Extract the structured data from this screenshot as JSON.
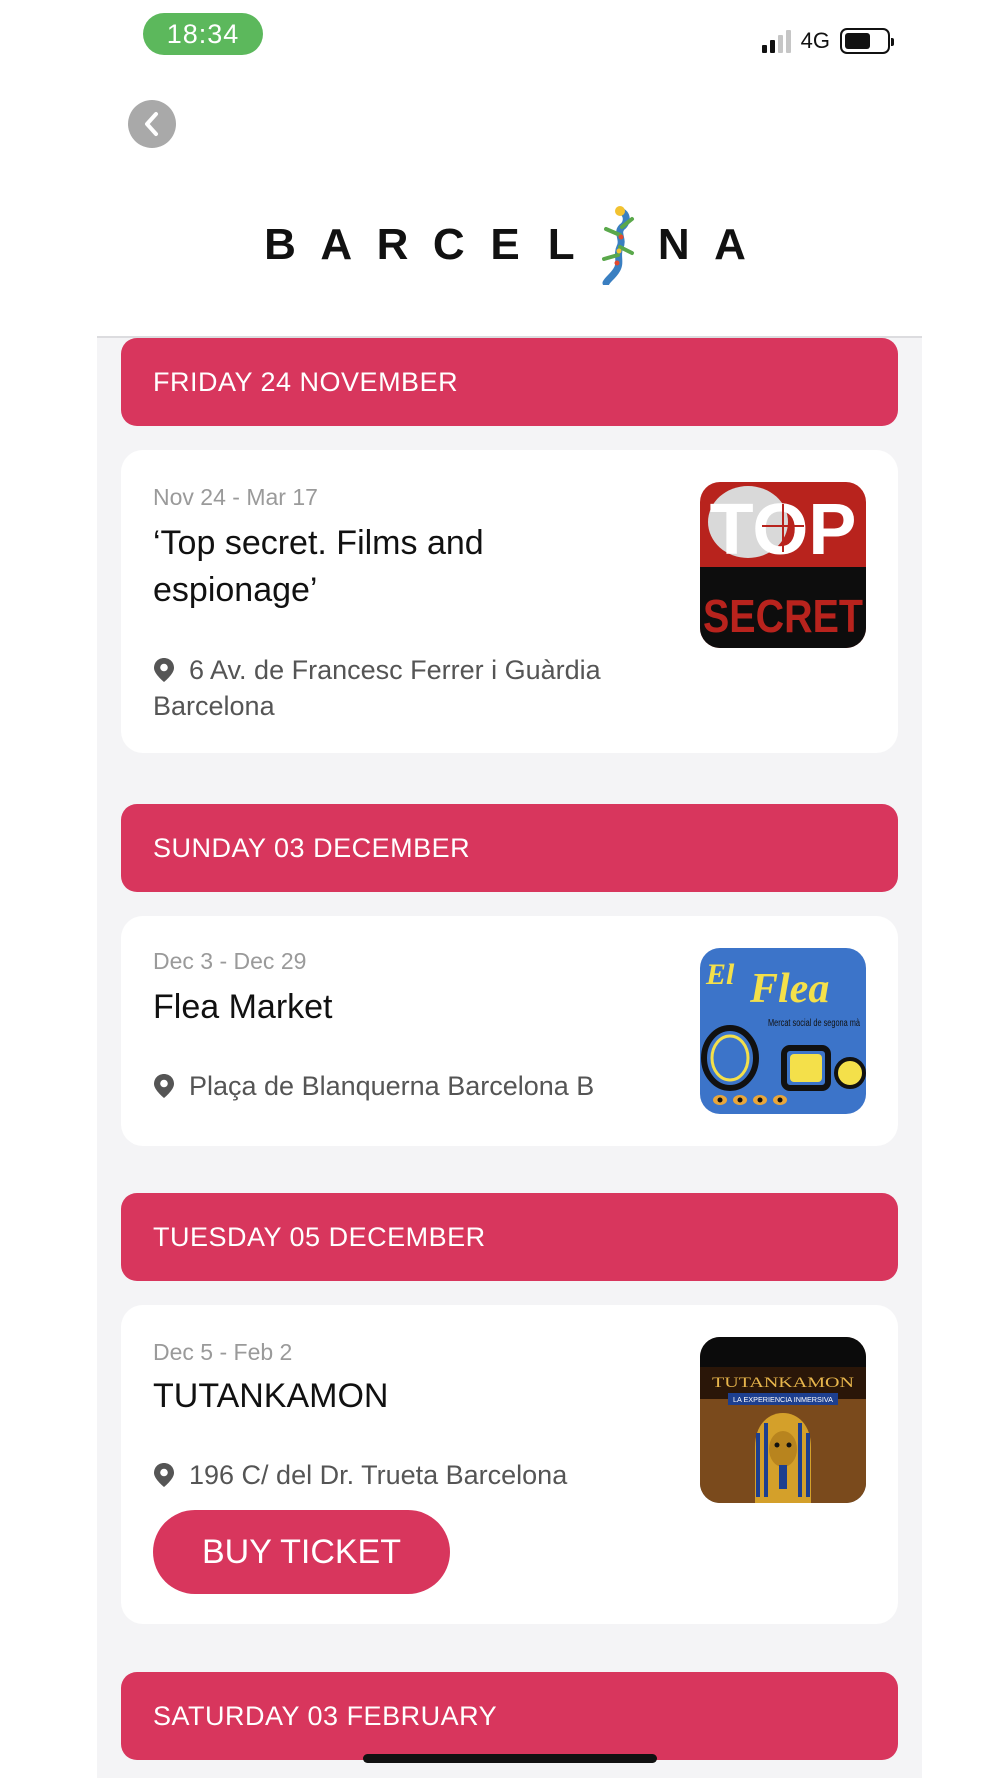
{
  "status_bar": {
    "time": "18:34",
    "network": "4G"
  },
  "header": {
    "back_icon": "chevron-left-icon",
    "logo_letters": [
      "B",
      "A",
      "R",
      "C",
      "E",
      "L",
      "O",
      "N",
      "A"
    ]
  },
  "colors": {
    "accent": "#d8365d",
    "time_pill": "#5cb85c",
    "background": "#f4f4f6"
  },
  "sections": [
    {
      "date_label": "FRIDAY 24 NOVEMBER",
      "event": {
        "dates": "Nov 24 - Mar 17",
        "title": "‘Top secret. Films and espionage’",
        "location": "6 Av. de Francesc Ferrer i Guàrdia Barcelona",
        "thumbnail_text": [
          "TOP",
          "SECRET"
        ]
      }
    },
    {
      "date_label": "SUNDAY 03 DECEMBER",
      "event": {
        "dates": "Dec 3 - Dec 29",
        "title": "Flea Market",
        "location": "Plaça de Blanquerna Barcelona B",
        "thumbnail_text": [
          "El",
          "Flea",
          "Mercat social de segona mà"
        ]
      }
    },
    {
      "date_label": "TUESDAY 05 DECEMBER",
      "event": {
        "dates": "Dec 5 - Feb 2",
        "title": "TUTANKAMON",
        "location": "196 C/ del Dr. Trueta Barcelona",
        "buy_label": "BUY TICKET",
        "thumbnail_text": [
          "TUTANKAMON",
          "LA EXPERIENCIA INMERSIVA"
        ]
      }
    },
    {
      "date_label": "SATURDAY 03 FEBRUARY"
    }
  ]
}
